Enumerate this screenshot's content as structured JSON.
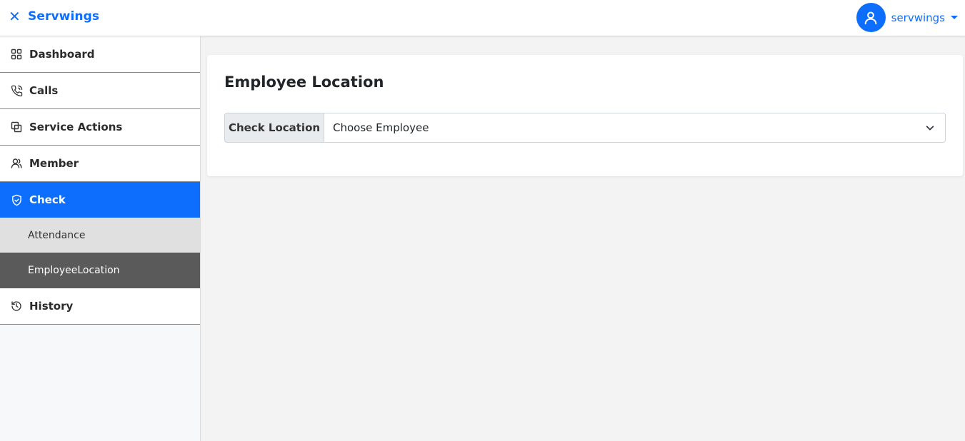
{
  "header": {
    "brand": "Servwings",
    "close_icon": "close-icon",
    "user_name": "servwings",
    "avatar_icon": "user-icon",
    "accent": "#0d6efd"
  },
  "sidebar": {
    "items": [
      {
        "label": "Dashboard",
        "icon": "grid-icon"
      },
      {
        "label": "Calls",
        "icon": "phone-icon"
      },
      {
        "label": "Service Actions",
        "icon": "copy-icon"
      },
      {
        "label": "Member",
        "icon": "person-icon"
      },
      {
        "label": "Check",
        "icon": "shield-check-icon",
        "active": true,
        "children": [
          {
            "label": "Attendance"
          },
          {
            "label": "EmployeeLocation",
            "selected": true
          }
        ]
      },
      {
        "label": "History",
        "icon": "history-icon"
      }
    ]
  },
  "main": {
    "title": "Employee Location",
    "form": {
      "label": "Check Location",
      "select_value": "Choose Employee"
    }
  }
}
